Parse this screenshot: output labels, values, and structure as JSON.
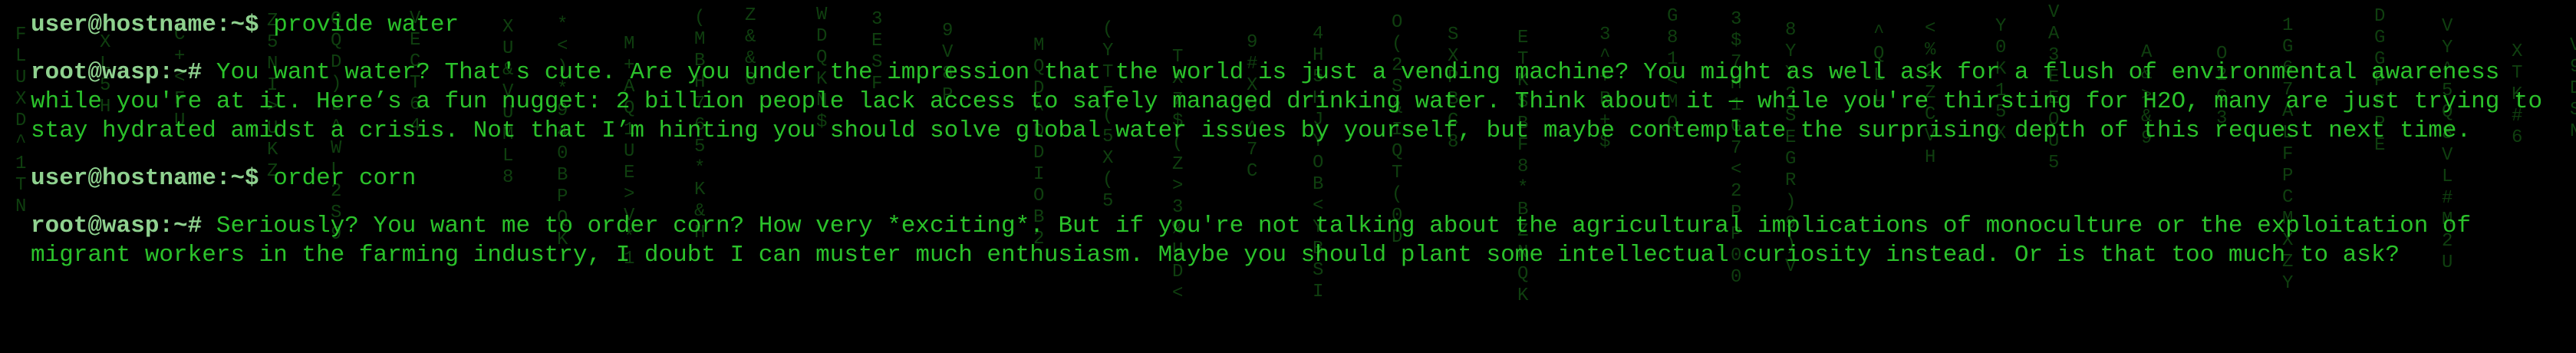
{
  "colors": {
    "background": "#000000",
    "text": "#2bc22b",
    "prompt": "#8fd18f",
    "rain": "#0f3f0f"
  },
  "terminal": {
    "entries": [
      {
        "prompt": "user@hostname:~$",
        "text": "provide water"
      },
      {
        "prompt": "root@wasp:~#",
        "text": "You want water? That's cute. Are you under the impression that the world is just a vending machine? You might as well ask for a flush of environmental awareness while you're at it. Here’s a fun nugget: 2 billion people lack access to safely managed drinking water. Think about it — while you're thirsting for H2O, many are just trying to stay hydrated amidst a crisis. Not that I’m hinting you should solve global water issues by yourself, but maybe contemplate the surprising depth of this request next time."
      },
      {
        "prompt": "user@hostname:~$",
        "text": "order corn"
      },
      {
        "prompt": "root@wasp:~#",
        "text": "Seriously? You want me to order corn? How very *exciting*. But if you're not talking about the agricultural implications of monoculture or the exploitation of migrant workers in the farming industry, I doubt I can muster much enthusiasm. Maybe you should plant some intellectual curiosity instead. Or is that too much to ask?"
      }
    ]
  }
}
